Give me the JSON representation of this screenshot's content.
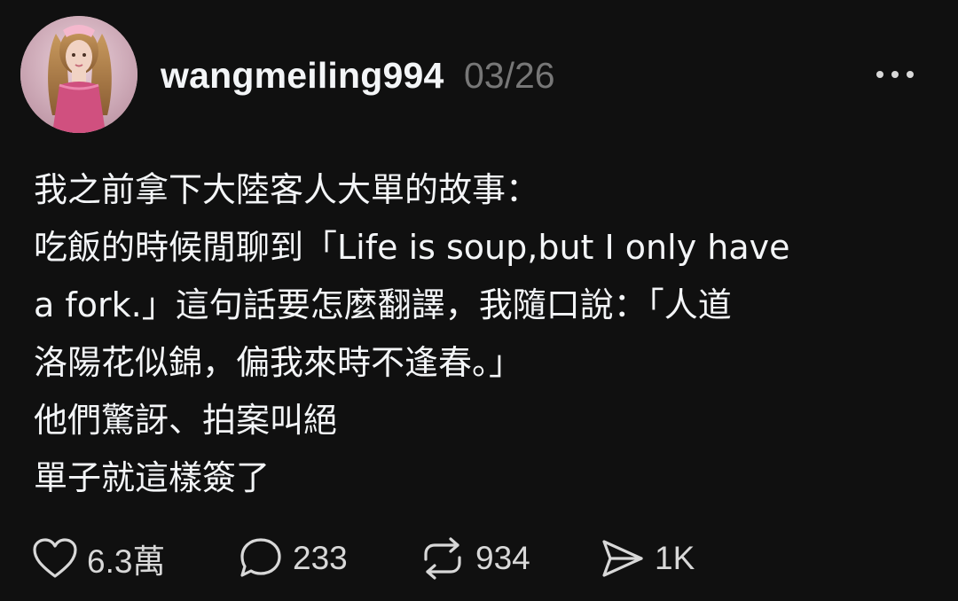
{
  "post": {
    "username": "wangmeiling994",
    "date": "03/26",
    "more_icon": "more-horizontal-icon",
    "body_lines": [
      "我之前拿下大陸客人大單的故事：",
      "吃飯的時候閒聊到「Life is soup,but I only have",
      "a fork.」這句話要怎麼翻譯，我隨口說：「人道",
      "洛陽花似錦，偏我來時不逢春。」",
      "他們驚訝、拍案叫絕",
      "單子就這樣簽了"
    ]
  },
  "actions": {
    "like": {
      "icon": "heart-icon",
      "count": "6.3萬"
    },
    "comment": {
      "icon": "comment-icon",
      "count": "233"
    },
    "repost": {
      "icon": "repost-icon",
      "count": "934"
    },
    "share": {
      "icon": "send-icon",
      "count": "1K"
    }
  },
  "colors": {
    "background": "#101010",
    "text": "#f3f5f7",
    "muted": "#777777",
    "icon": "#d8d8d8"
  }
}
